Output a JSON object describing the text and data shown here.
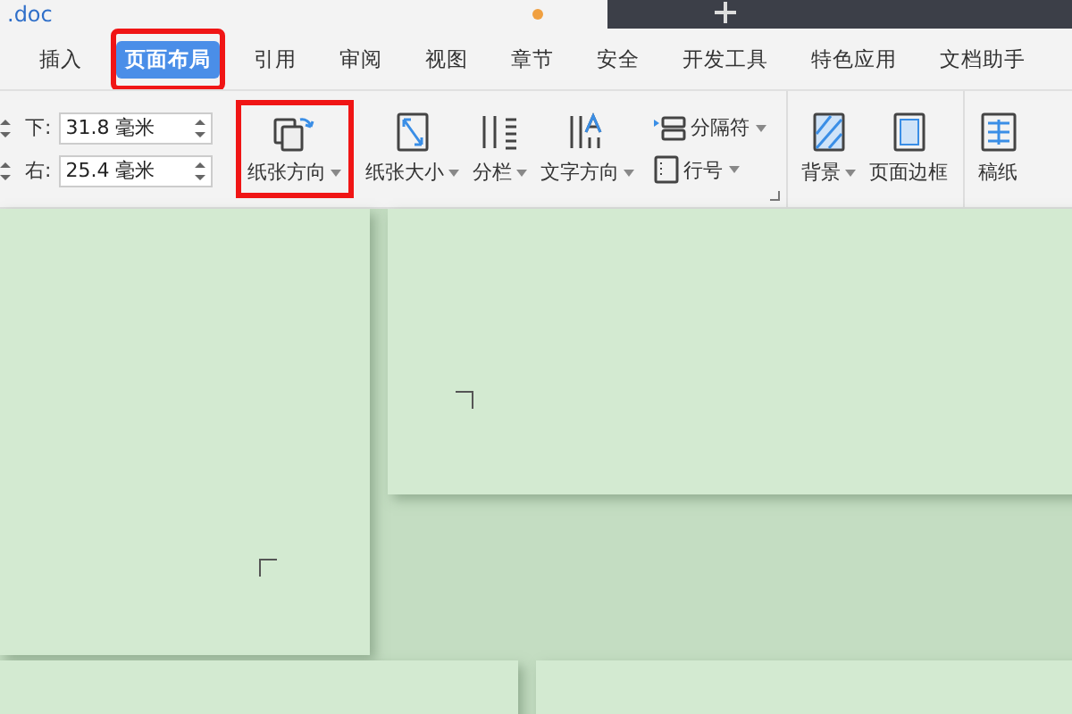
{
  "doc_tab": {
    "title": ".doc",
    "unsaved": true
  },
  "menu_tabs": [
    {
      "label": "插入",
      "selected": false,
      "highlighted": false
    },
    {
      "label": "页面布局",
      "selected": true,
      "highlighted": true
    },
    {
      "label": "引用",
      "selected": false,
      "highlighted": false
    },
    {
      "label": "审阅",
      "selected": false,
      "highlighted": false
    },
    {
      "label": "视图",
      "selected": false,
      "highlighted": false
    },
    {
      "label": "章节",
      "selected": false,
      "highlighted": false
    },
    {
      "label": "安全",
      "selected": false,
      "highlighted": false
    },
    {
      "label": "开发工具",
      "selected": false,
      "highlighted": false
    },
    {
      "label": "特色应用",
      "selected": false,
      "highlighted": false
    },
    {
      "label": "文档助手",
      "selected": false,
      "highlighted": false
    }
  ],
  "margins": [
    {
      "label": "下:",
      "value": "31.8 毫米"
    },
    {
      "label": "右:",
      "value": "25.4 毫米"
    }
  ],
  "ribbon_groups": [
    [
      {
        "kind": "large",
        "label": "纸张方向",
        "dropdown": true,
        "highlighted": true
      },
      {
        "kind": "large",
        "label": "纸张大小",
        "dropdown": true,
        "highlighted": false
      },
      {
        "kind": "large",
        "label": "分栏",
        "dropdown": true,
        "highlighted": false
      },
      {
        "kind": "large",
        "label": "文字方向",
        "dropdown": true,
        "highlighted": false
      },
      {
        "kind": "small",
        "label": "分隔符",
        "dropdown": true,
        "highlighted": false
      },
      {
        "kind": "small",
        "label": "行号",
        "dropdown": true,
        "highlighted": false
      }
    ],
    [
      {
        "kind": "large",
        "label": "背景",
        "dropdown": true,
        "highlighted": false
      },
      {
        "kind": "large",
        "label": "页面边框",
        "dropdown": false,
        "highlighted": false
      }
    ],
    [
      {
        "kind": "large",
        "label": "稿纸",
        "dropdown": false,
        "highlighted": false
      }
    ]
  ]
}
